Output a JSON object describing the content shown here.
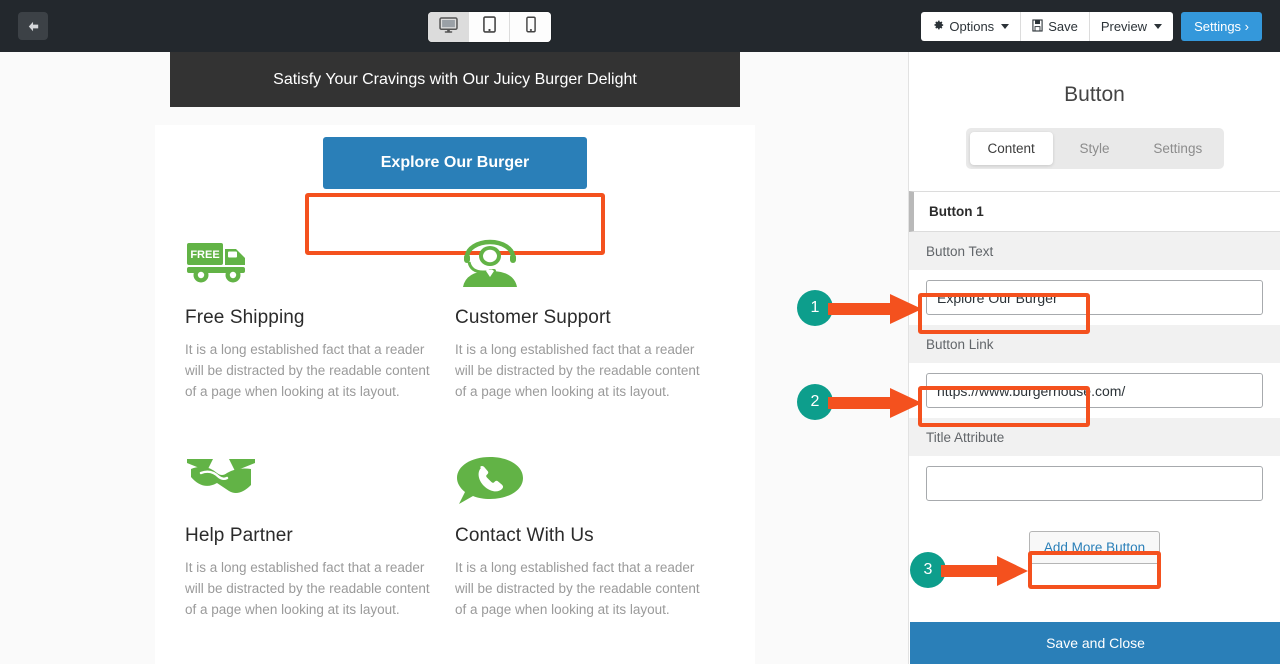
{
  "topbar": {
    "back_icon": "arrow-left-icon",
    "devices": [
      {
        "name": "desktop",
        "icon": "desktop-icon",
        "active": true
      },
      {
        "name": "tablet",
        "icon": "tablet-icon",
        "active": false
      },
      {
        "name": "mobile",
        "icon": "mobile-icon",
        "active": false
      }
    ],
    "options_label": "Options",
    "options_icon": "gear-icon",
    "save_label": "Save",
    "save_icon": "save-disk-icon",
    "preview_label": "Preview",
    "settings_label": "Settings ›"
  },
  "canvas": {
    "hero_text": "Satisfy Your Cravings with Our Juicy Burger Delight",
    "explore_button_label": "Explore Our Burger",
    "features": [
      {
        "icon": "free-shipping-truck-icon",
        "title": "Free Shipping",
        "desc": "It is a long established fact that a reader will be distracted by the readable content of a page when looking at its layout."
      },
      {
        "icon": "customer-support-headset-icon",
        "title": "Customer Support",
        "desc": "It is a long established fact that a reader will be distracted by the readable content of a page when looking at its layout."
      },
      {
        "icon": "handshake-icon",
        "title": "Help Partner",
        "desc": "It is a long established fact that a reader will be distracted by the readable content of a page when looking at its layout."
      },
      {
        "icon": "phone-chat-bubble-icon",
        "title": "Contact With Us",
        "desc": "It is a long established fact that a reader will be distracted by the readable content of a page when looking at its layout."
      }
    ]
  },
  "panel": {
    "title": "Button",
    "tabs": [
      {
        "label": "Content",
        "active": true
      },
      {
        "label": "Style",
        "active": false
      },
      {
        "label": "Settings",
        "active": false
      }
    ],
    "accordion_label": "Button 1",
    "fields": [
      {
        "label": "Button Text",
        "value": "Explore Our Burger",
        "placeholder": ""
      },
      {
        "label": "Button Link",
        "value": "https://www.burgerhouse.com/",
        "placeholder": ""
      },
      {
        "label": "Title Attribute",
        "value": "",
        "placeholder": ""
      }
    ],
    "add_more_label": "Add More Button",
    "save_close_label": "Save and Close"
  },
  "annotations": {
    "badges": [
      "1",
      "2",
      "3"
    ],
    "badge_color": "#0d9e8c",
    "highlight_color": "#f4511e"
  }
}
